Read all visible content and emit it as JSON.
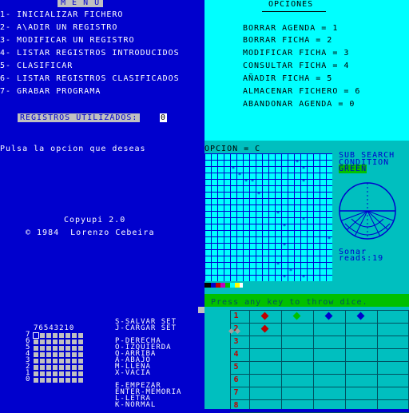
{
  "menu": {
    "title": "M E N U",
    "items": [
      "1- INICIALIZAR FICHERO",
      "2- A\\ADIR UN REGISTRO",
      "3- MODIFICAR UN REGISTRO",
      "4- LISTAR REGISTROS INTRODUCIDOS",
      "5- CLASIFICAR",
      "6- LISTAR REGISTROS CLASIFICADOS",
      "7- GRABAR PROGRAMA"
    ],
    "registros_label": "REGISTROS UTILIZADOS:",
    "registros_value": "0"
  },
  "opciones": {
    "title": "OPCIONES",
    "items": [
      "BORRAR AGENDA = 1",
      "BORRAR FICHA = 2",
      "MODIFICAR FICHA = 3",
      "CONSULTAR FICHA = 4",
      "AÑADIR FICHA = 5",
      "ALMACENAR FICHERO = 6",
      "ABANDONAR AGENDA = 0"
    ]
  },
  "prompt": "Pulsa la opcion que deseas",
  "copyright": {
    "line1": "Copyupi 2.0",
    "line2": "© 1984  Lorenzo Cebeira"
  },
  "editor": {
    "bit_header": "76543210",
    "row_numbers": [
      "7",
      "6",
      "5",
      "4",
      "3",
      "2",
      "1",
      "0"
    ],
    "controls": [
      "S-SALVAR SET",
      "J-CARGAR SET",
      "",
      "P-DERECHA",
      "O-IZQUIERDA",
      "Q-ARRIBA",
      "A-ABAJO",
      "M-LLENA",
      "X-VACIA",
      "",
      "E-EMPEZAR",
      "ENTER-MEMORIA",
      "L-LETRA",
      "K-NORMAL"
    ]
  },
  "game": {
    "opcion_label": "OPCION = C",
    "sub_search": "SUB SEARCH",
    "condition": "CONDITION",
    "condition_value": "GREEN",
    "sonar_label": "Sonar",
    "sonar_reads": "reads:19",
    "dice_prompt": "Press any key to throw dice.",
    "dice_rows": [
      "1",
      "2",
      "3",
      "4",
      "5",
      "6",
      "7",
      "8"
    ]
  },
  "colors": {
    "blue": "#0000cd",
    "cyan": "#00ffff",
    "teal": "#00bfbf",
    "green": "#00c000",
    "red": "#c00000"
  }
}
